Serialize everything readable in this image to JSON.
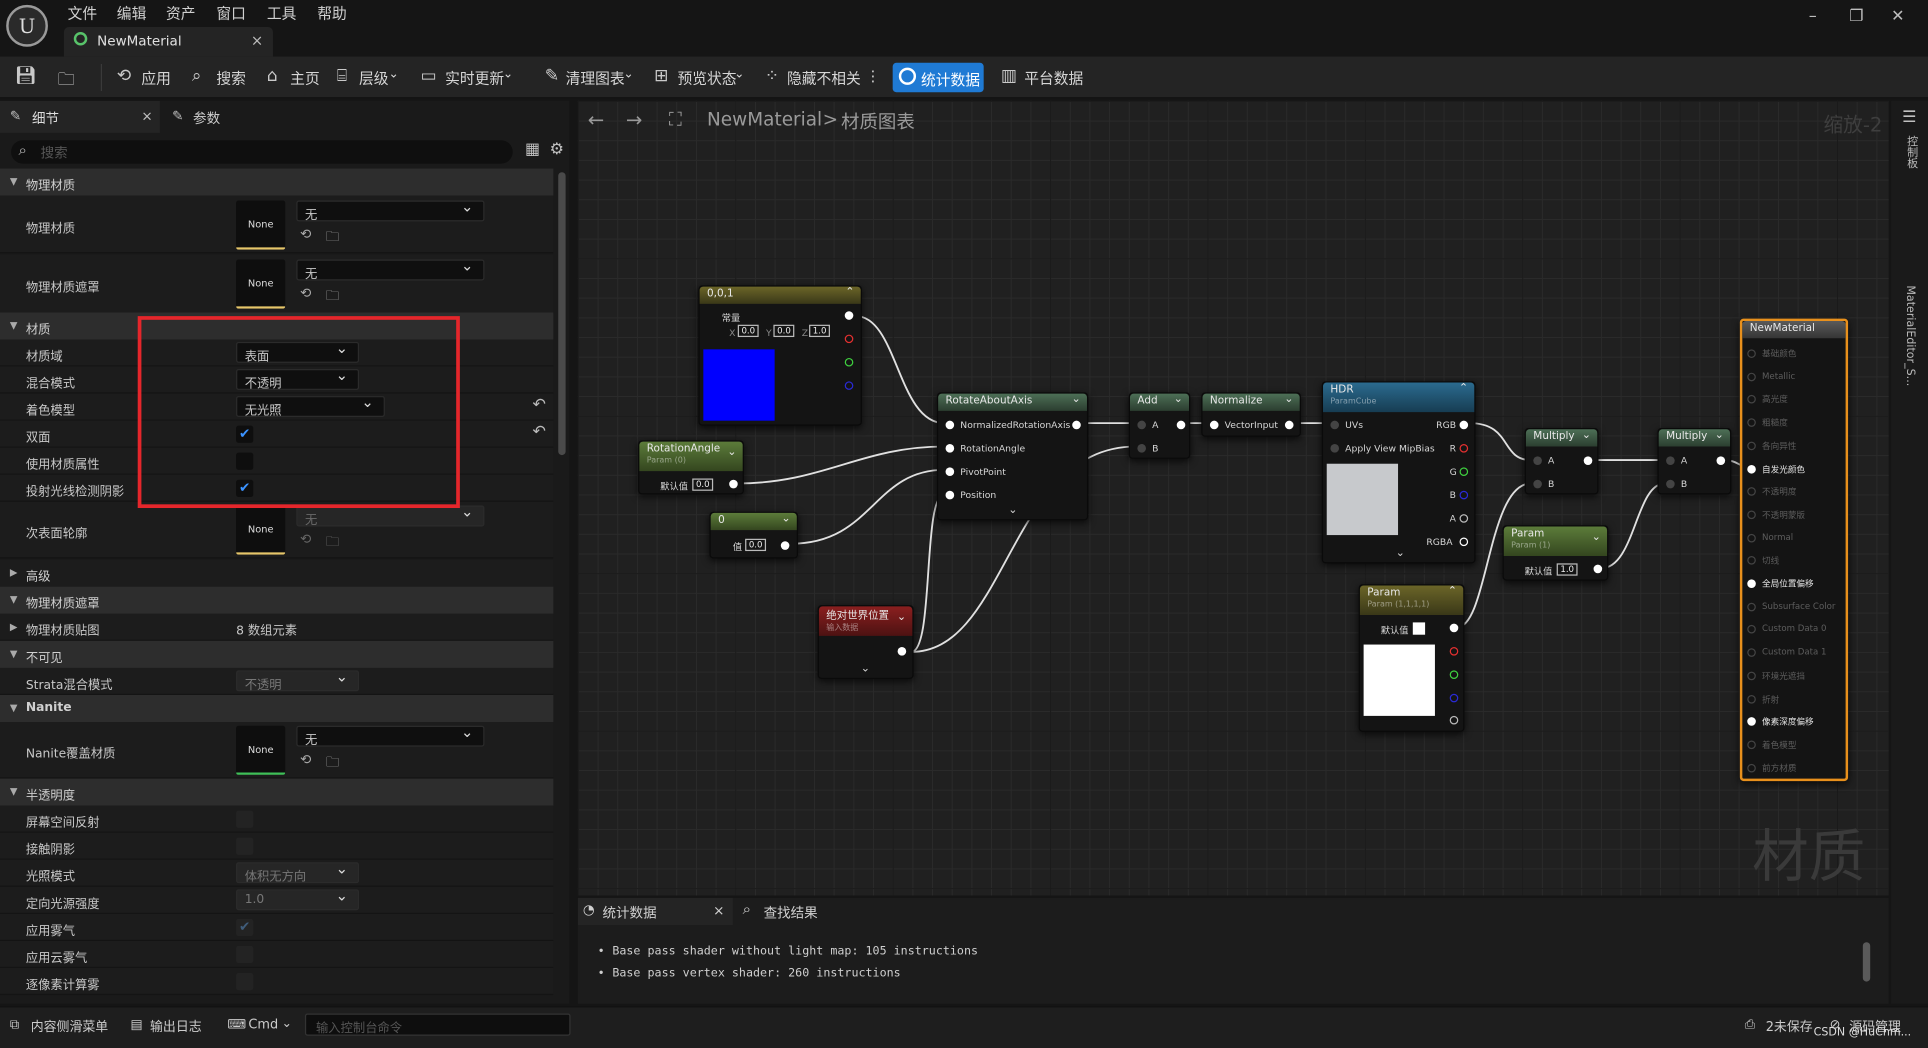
{
  "menu": [
    "文件",
    "编辑",
    "资产",
    "窗口",
    "工具",
    "帮助"
  ],
  "document_tab": {
    "title": "NewMaterial",
    "close": "×"
  },
  "window_controls": {
    "minimize": "–",
    "restore": "❐",
    "close": "✕"
  },
  "toolbar": {
    "apply": "应用",
    "search": "搜索",
    "home": "主页",
    "hierarchy": "层级",
    "live_update": "实时更新",
    "clean_graph": "清理图表",
    "preview_state": "预览状态",
    "hide_unrelated": "隐藏不相关",
    "stats": "统计数据",
    "platform_stats": "平台数据"
  },
  "left_panel": {
    "tabs": {
      "details": "细节",
      "parameters": "参数"
    },
    "search_placeholder": "搜索",
    "sections": {
      "phys_mat": "物理材质",
      "material": "材质",
      "advanced": "高级",
      "phys_mat_mask": "物理材质遮罩",
      "invisible": "不可见",
      "nanite": "Nanite",
      "translucency": "半透明度"
    },
    "thumb_none": "None",
    "rows": {
      "phys_mat": {
        "label": "物理材质",
        "value": "无"
      },
      "phys_mat_mask": {
        "label": "物理材质遮罩",
        "value": "无"
      },
      "material_domain": {
        "label": "材质域",
        "value": "表面"
      },
      "blend_mode": {
        "label": "混合模式",
        "value": "不透明"
      },
      "shading_model": {
        "label": "着色模型",
        "value": "无光照"
      },
      "two_sided": {
        "label": "双面",
        "checked": true
      },
      "use_material_attributes": {
        "label": "使用材质属性",
        "checked": false
      },
      "cast_ray_traced_shadows": {
        "label": "投射光线检测阴影",
        "checked": true
      },
      "subsurface_profile": {
        "label": "次表面轮廓",
        "value": "无"
      },
      "phys_mat_map": {
        "label": "物理材质贴图",
        "value": "8 数组元素"
      },
      "strata_blend": {
        "label": "Strata混合模式",
        "value": "不透明"
      },
      "nanite_override": {
        "label": "Nanite覆盖材质",
        "value": "无"
      },
      "ssr": {
        "label": "屏幕空间反射"
      },
      "contact_shadows": {
        "label": "接触阴影"
      },
      "lighting_mode": {
        "label": "光照模式",
        "value": "体积无方向"
      },
      "directional_intensity": {
        "label": "定向光源强度",
        "value": "1.0"
      },
      "apply_fog": {
        "label": "应用雾气",
        "checked": true
      },
      "apply_cloud_fog": {
        "label": "应用云雾气"
      },
      "per_pixel_fog": {
        "label": "逐像素计算雾"
      }
    }
  },
  "graph": {
    "breadcrumb_root": "NewMaterial",
    "breadcrumb_sep": ">",
    "breadcrumb_leaf": "材质图表",
    "zoom": "缩放-2",
    "watermark": "材质",
    "nodes": {
      "constant3": {
        "title": "0,0,1",
        "sub": "常量",
        "x": "0.0",
        "y": "0.0",
        "z": "1.0",
        "color": "#0000ff"
      },
      "rotation_angle": {
        "title": "RotationAngle",
        "sub": "Param (0)",
        "default_label": "默认值",
        "default": "0.0"
      },
      "scalar0": {
        "title": "0",
        "value_label": "值",
        "value": "0.0"
      },
      "rotate": {
        "title": "RotateAboutAxis",
        "pins": [
          "NormalizedRotationAxis",
          "RotationAngle",
          "PivotPoint",
          "Position"
        ]
      },
      "add": {
        "title": "Add",
        "pins": [
          "A",
          "B"
        ]
      },
      "normalize": {
        "title": "Normalize",
        "pins": [
          "VectorInput"
        ]
      },
      "hdr": {
        "title": "HDR",
        "sub": "ParamCube",
        "pins": [
          "UVs",
          "Apply View MipBias"
        ],
        "outputs": [
          "RGB",
          "R",
          "G",
          "B",
          "A",
          "RGBA"
        ]
      },
      "multiply1": {
        "title": "Multiply",
        "pins": [
          "A",
          "B"
        ]
      },
      "multiply2": {
        "title": "Multiply",
        "pins": [
          "A",
          "B"
        ]
      },
      "param1": {
        "title": "Param",
        "sub": "Param (1)",
        "default_label": "默认值",
        "default": "1.0"
      },
      "param_color": {
        "title": "Param",
        "sub": "Param (1,1,1,1)",
        "default_label": "默认值"
      },
      "world_pos": {
        "title": "绝对世界位置",
        "sub": "输入数据"
      },
      "material": {
        "title": "NewMaterial",
        "pins": [
          {
            "label": "基础颜色",
            "on": false
          },
          {
            "label": "Metallic",
            "on": false
          },
          {
            "label": "高光度",
            "on": false
          },
          {
            "label": "粗糙度",
            "on": false
          },
          {
            "label": "各向异性",
            "on": false
          },
          {
            "label": "自发光颜色",
            "on": true
          },
          {
            "label": "不透明度",
            "on": false
          },
          {
            "label": "不透明蒙版",
            "on": false
          },
          {
            "label": "Normal",
            "on": false
          },
          {
            "label": "切线",
            "on": false
          },
          {
            "label": "全局位置偏移",
            "on": true
          },
          {
            "label": "Subsurface Color",
            "on": false
          },
          {
            "label": "Custom Data 0",
            "on": false
          },
          {
            "label": "Custom Data 1",
            "on": false
          },
          {
            "label": "环境光遮挡",
            "on": false
          },
          {
            "label": "折射",
            "on": false
          },
          {
            "label": "像素深度偏移",
            "on": true
          },
          {
            "label": "着色模型",
            "on": false
          },
          {
            "label": "前方材质",
            "on": false
          }
        ]
      }
    }
  },
  "right_strip": {
    "label1": "控制板",
    "label2": "MaterialEditor_S..."
  },
  "bottom_panel": {
    "tab_stats": "统计数据",
    "tab_close": "×",
    "tab_find": "查找结果",
    "lines": [
      "Base pass shader without light map: 105 instructions",
      "Base pass vertex shader: 260 instructions"
    ]
  },
  "status_bar": {
    "content_drawer": "内容侧滑菜单",
    "output_log": "输出日志",
    "cmd": "Cmd",
    "cmd_placeholder": "输入控制台命令",
    "unsaved": "2未保存",
    "source_control": "源码管理",
    "watermark": "CSDN @HuChm..."
  },
  "colors": {
    "accent": "#1f7ad4",
    "highlight_box": "#e5262b",
    "constant_swatch": "#0000ff",
    "material_border": "#e8901c"
  }
}
